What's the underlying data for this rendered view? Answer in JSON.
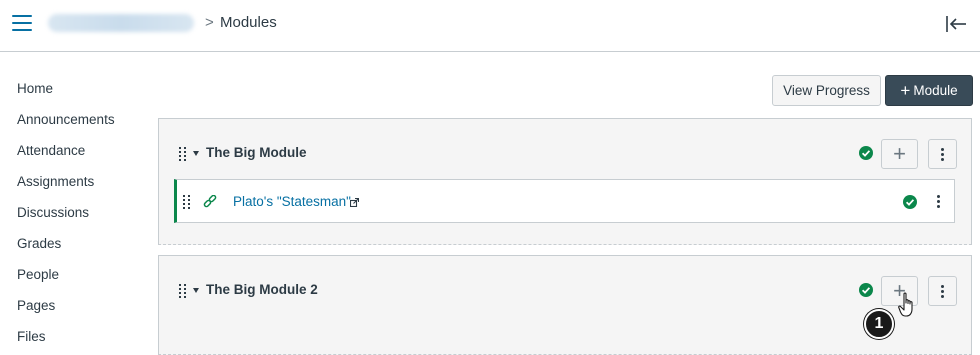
{
  "header": {
    "menu_icon": "hamburger-menu-icon",
    "breadcrumb_separator": ">",
    "breadcrumb_current": "Modules",
    "collapse_icon": "collapse-left-icon"
  },
  "sidebar": {
    "items": [
      {
        "label": "Home"
      },
      {
        "label": "Announcements"
      },
      {
        "label": "Attendance"
      },
      {
        "label": "Assignments"
      },
      {
        "label": "Discussions"
      },
      {
        "label": "Grades"
      },
      {
        "label": "People"
      },
      {
        "label": "Pages"
      },
      {
        "label": "Files"
      }
    ]
  },
  "toolbar": {
    "view_progress_label": "View Progress",
    "add_module_plus": "+",
    "add_module_label": "Module"
  },
  "modules": [
    {
      "title": "The Big Module",
      "published": true,
      "add_icon": "plus-icon",
      "items": [
        {
          "title": "Plato's \"Statesman\"",
          "type_icon": "link-icon",
          "external_icon": "external-link-icon",
          "published": true
        }
      ]
    },
    {
      "title": "The Big Module 2",
      "published": true,
      "add_icon": "plus-icon",
      "items": []
    }
  ],
  "annotation": {
    "step_number": "1",
    "cursor_icon": "hand-pointer-icon"
  },
  "colors": {
    "accent_link": "#0770a3",
    "published_green": "#0b874b",
    "primary_button": "#394b58",
    "module_background": "#f5f5f5",
    "border": "#c7cdd1"
  }
}
